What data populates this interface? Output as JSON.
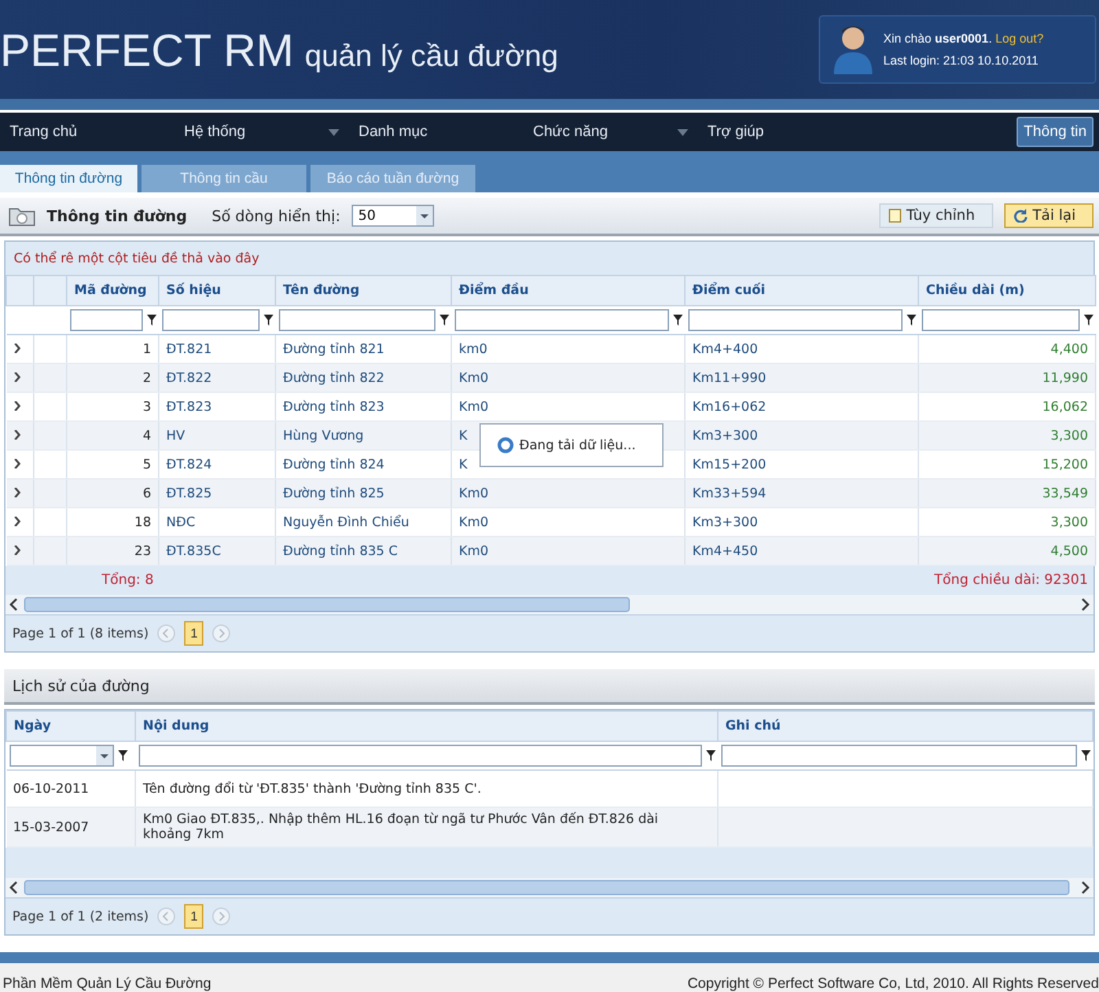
{
  "header": {
    "title": "PERFECT RM",
    "subtitle": "quản lý cầu đường",
    "greeting": "Xin chào **user0001**.",
    "logout": "Log out?",
    "last_login": "Last login: 21:03 10.10.2011"
  },
  "nav": {
    "items": [
      {
        "label": "Trang chủ",
        "has_dropdown": false
      },
      {
        "label": "Hệ thống",
        "has_dropdown": true
      },
      {
        "label": "Danh mục",
        "has_dropdown": false
      },
      {
        "label": "Chức năng",
        "has_dropdown": true
      },
      {
        "label": "Trợ giúp",
        "has_dropdown": false
      }
    ],
    "info_button": "Thông tin"
  },
  "tabs": [
    {
      "label": "Thông tin đường",
      "selected": true
    },
    {
      "label": "Thông tin cầu",
      "selected": false
    },
    {
      "label": "Báo cáo tuần đường",
      "selected": false
    }
  ],
  "toolbar": {
    "title": "Thông tin đường",
    "rows_label": "Số dòng hiển thị:",
    "rows_value": "50",
    "buttons": [
      {
        "label": "Tùy chỉnh",
        "kind": "customize",
        "active": false
      },
      {
        "label": "Tải lại",
        "kind": "reload",
        "active": true
      }
    ]
  },
  "grid": {
    "group_hint": "Có thể rê một cột tiêu đề thả vào đây",
    "columns": [
      "Mã đường",
      "Số hiệu",
      "Tên đường",
      "Điểm đầu",
      "Điểm cuối",
      "Chiều dài (m)"
    ],
    "rows": [
      [
        "1",
        "ĐT.821",
        "Đường tỉnh 821",
        "km0",
        "Km4+400",
        "4,400"
      ],
      [
        "2",
        "ĐT.822",
        "Đường tỉnh 822",
        "Km0",
        "Km11+990",
        "11,990"
      ],
      [
        "3",
        "ĐT.823",
        "Đường tỉnh 823",
        "Km0",
        "Km16+062",
        "16,062"
      ],
      [
        "4",
        "HV",
        "Hùng Vương",
        "K",
        "Km3+300",
        "3,300"
      ],
      [
        "5",
        "ĐT.824",
        "Đường tỉnh 824",
        "K",
        "Km15+200",
        "15,200"
      ],
      [
        "6",
        "ĐT.825",
        "Đường tỉnh 825",
        "Km0",
        "Km33+594",
        "33,549"
      ],
      [
        "18",
        "NĐC",
        "Nguyễn Đình Chiểu",
        "Km0",
        "Km3+300",
        "3,300"
      ],
      [
        "23",
        "ĐT.835C",
        "Đường tỉnh 835 C",
        "Km0",
        "Km4+450",
        "4,500"
      ]
    ],
    "count": "Tổng: 8",
    "total": "Tổng chiều dài: 92301",
    "loading": "Đang tải dữ liệu...",
    "pager": "Page 1 of 1 (8 items)",
    "pages": [
      {
        "label": "1",
        "selected": true
      }
    ]
  },
  "history": {
    "title": "Lịch sử của đường",
    "columns": [
      "Ngày",
      "Nội dung",
      "Ghi chú"
    ],
    "rows": [
      [
        "06-10-2011",
        "Tên đường đổi từ 'ĐT.835' thành 'Đường tỉnh 835 C'.",
        ""
      ],
      [
        "15-03-2007",
        "Km0 Giao ĐT.835,. Nhập thêm HL.16 đoạn từ ngã tư Phước Vân đến ĐT.826 dài khoảng 7km",
        ""
      ]
    ],
    "pager": "Page 1 of 1 (2 items)",
    "pages": [
      {
        "label": "1",
        "selected": true
      }
    ]
  },
  "footer": {
    "left": "Phần Mềm Quản Lý Cầu Đường",
    "right": "Copyright © Perfect Software Co, Ltd, 2010. All Rights Reserved"
  }
}
